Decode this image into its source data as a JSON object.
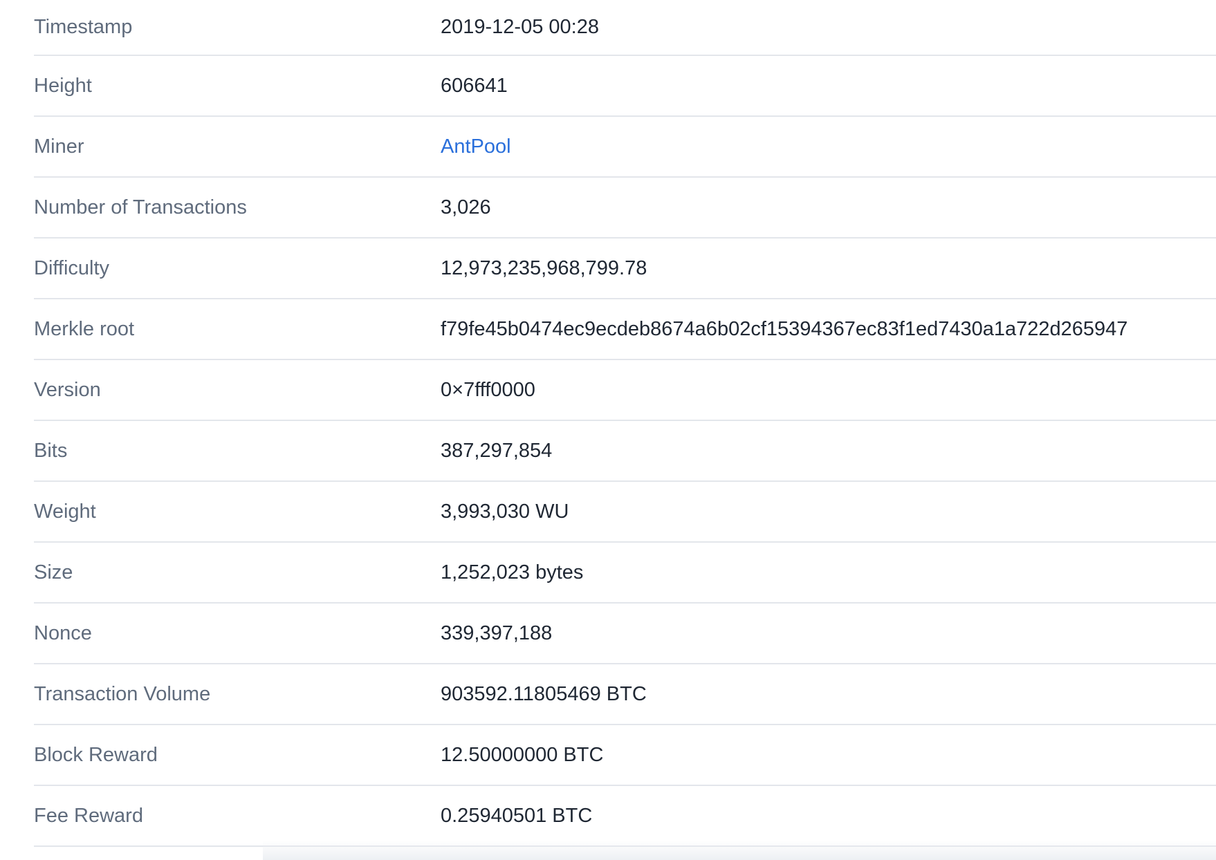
{
  "block_details": {
    "rows": [
      {
        "label": "Timestamp",
        "value": "2019-12-05 00:28"
      },
      {
        "label": "Height",
        "value": "606641"
      },
      {
        "label": "Miner",
        "value": "AntPool"
      },
      {
        "label": "Number of Transactions",
        "value": "3,026"
      },
      {
        "label": "Difficulty",
        "value": "12,973,235,968,799.78"
      },
      {
        "label": "Merkle root",
        "value": "f79fe45b0474ec9ecdeb8674a6b02cf15394367ec83f1ed7430a1a722d265947"
      },
      {
        "label": "Version",
        "value": "0×7fff0000"
      },
      {
        "label": "Bits",
        "value": "387,297,854"
      },
      {
        "label": "Weight",
        "value": "3,993,030 WU"
      },
      {
        "label": "Size",
        "value": "1,252,023 bytes"
      },
      {
        "label": "Nonce",
        "value": "339,397,188"
      },
      {
        "label": "Transaction Volume",
        "value": "903592.11805469 BTC"
      },
      {
        "label": "Block Reward",
        "value": "12.50000000 BTC"
      },
      {
        "label": "Fee Reward",
        "value": "0.25940501 BTC"
      }
    ]
  },
  "colors": {
    "label": "#5f6b7c",
    "value": "#1f2733",
    "link": "#2a6fdb",
    "divider": "#e3e6eb"
  }
}
